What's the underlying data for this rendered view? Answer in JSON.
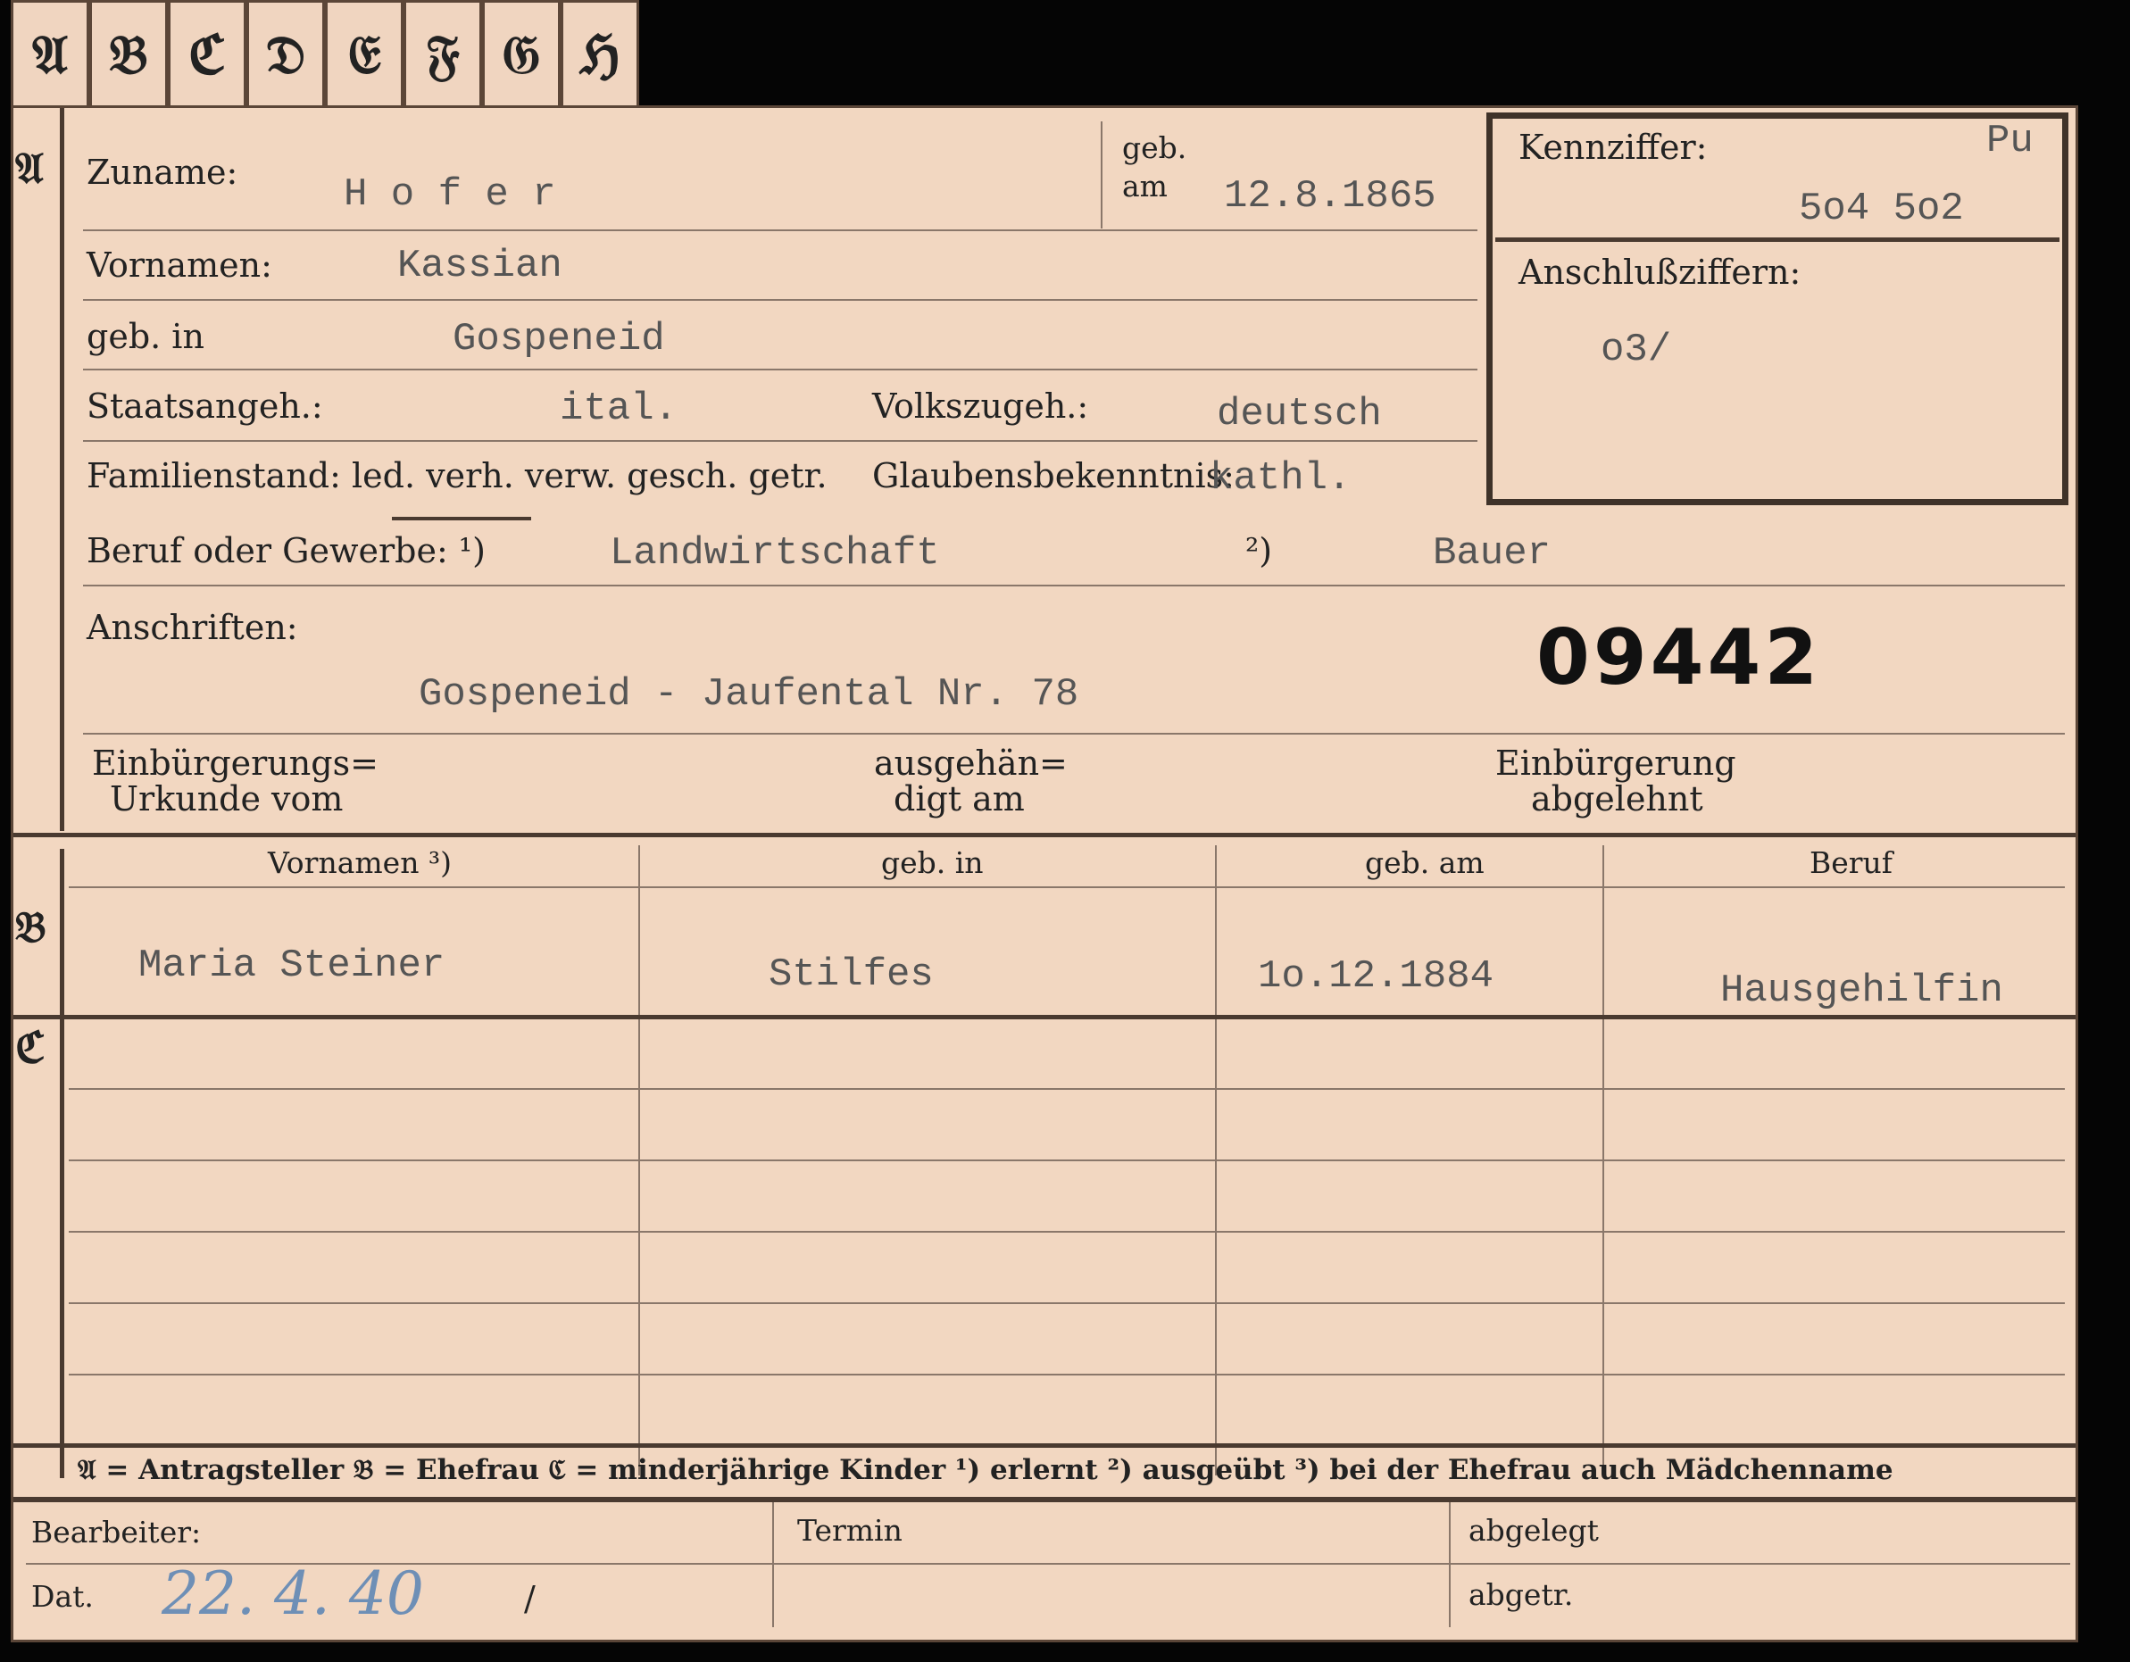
{
  "tabs": [
    "𝔄",
    "𝔅",
    "ℭ",
    "𝔇",
    "𝔈",
    "𝔉",
    "𝔊",
    "ℌ"
  ],
  "sections": {
    "a": "𝔄",
    "b": "𝔅",
    "c": "ℭ"
  },
  "labels": {
    "zuname": "Zuname:",
    "geb": "geb.",
    "am": "am",
    "kennziffer": "Kennziffer:",
    "anschlussziffern": "Anschlußziffern:",
    "vornamen": "Vornamen:",
    "geb_in": "geb. in",
    "staatsangeh": "Staatsangeh.:",
    "volkszugeh": "Volkszugeh.:",
    "familienstand": "Familienstand: led. verh. verw. gesch. getr.",
    "glaubens": "Glaubensbekenntnis:",
    "beruf": "Beruf oder Gewerbe: ¹)",
    "beruf2": "²)",
    "anschriften": "Anschriften:",
    "einb1": "Einbürgerungs=",
    "einb2": "Urkunde vom",
    "ausg1": "ausgehän=",
    "ausg2": "digt am",
    "abgl1": "Einbürgerung",
    "abgl2": "abgelehnt"
  },
  "values": {
    "zuname": "H o f e r",
    "geb_am": "12.8.1865",
    "kennziffer_prefix": "Pu",
    "kennziffer": "5o4 5o2",
    "anschlussziffern": "o3/",
    "vornamen": "Kassian",
    "geb_in": "Gospeneid",
    "staatsangeh": "ital.",
    "volkszugeh": "deutsch",
    "glaubens": "kathl.",
    "beruf_erlernt": "Landwirtschaft",
    "beruf_ausgeuebt": "Bauer",
    "anschrift": "Gospeneid - Jaufental Nr. 78",
    "stamp_number": "09442"
  },
  "table": {
    "headers": [
      "Vornamen ³)",
      "geb. in",
      "geb. am",
      "Beruf"
    ],
    "row": [
      "Maria  Steiner",
      "Stilfes",
      "1o.12.1884",
      "Hausgehilfin"
    ]
  },
  "legend": "𝔄 = Antragsteller   𝔅 = Ehefrau   ℭ = minderjährige Kinder   ¹) erlernt   ²) ausgeübt   ³) bei der Ehefrau auch Mädchenname",
  "footer": {
    "bearbeiter": "Bearbeiter:",
    "dat": "Dat.",
    "dat_value": "22. 4. 40",
    "slash": "/",
    "termin": "Termin",
    "abgelegt": "abgelegt",
    "abgetr": "abgetr."
  }
}
